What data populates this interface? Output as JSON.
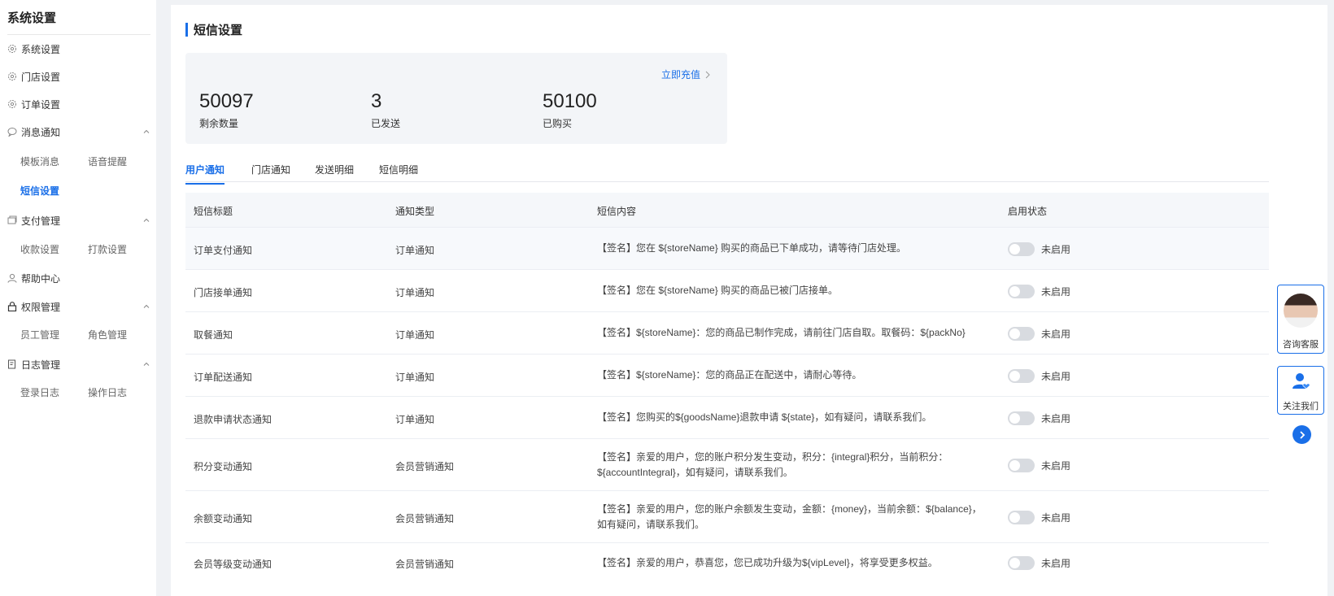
{
  "sidebar": {
    "title": "系统设置",
    "items": [
      {
        "label": "系统设置",
        "icon": "gear-icon"
      },
      {
        "label": "门店设置",
        "icon": "gear-icon"
      },
      {
        "label": "订单设置",
        "icon": "gear-icon"
      },
      {
        "label": "消息通知",
        "icon": "chat-icon",
        "sub": [
          "模板消息",
          "语音提醒",
          "短信设置"
        ]
      },
      {
        "label": "支付管理",
        "icon": "wallet-icon",
        "sub": [
          "收款设置",
          "打款设置"
        ]
      },
      {
        "label": "帮助中心",
        "icon": "user-icon"
      },
      {
        "label": "权限管理",
        "icon": "lock-icon",
        "sub": [
          "员工管理",
          "角色管理"
        ]
      },
      {
        "label": "日志管理",
        "icon": "log-icon",
        "sub": [
          "登录日志",
          "操作日志"
        ]
      }
    ]
  },
  "page": {
    "title": "短信设置"
  },
  "stats": {
    "recharge_label": "立即充值",
    "items": [
      {
        "value": "50097",
        "label": "剩余数量"
      },
      {
        "value": "3",
        "label": "已发送"
      },
      {
        "value": "50100",
        "label": "已购买"
      }
    ]
  },
  "tabs": [
    "用户通知",
    "门店通知",
    "发送明细",
    "短信明细"
  ],
  "table": {
    "headers": [
      "短信标题",
      "通知类型",
      "短信内容",
      "启用状态"
    ],
    "rows": [
      {
        "title": "订单支付通知",
        "type": "订单通知",
        "content": "【签名】您在 ${storeName} 购买的商品已下单成功，请等待门店处理。",
        "status": "未启用"
      },
      {
        "title": "门店接单通知",
        "type": "订单通知",
        "content": "【签名】您在 ${storeName} 购买的商品已被门店接单。",
        "status": "未启用"
      },
      {
        "title": "取餐通知",
        "type": "订单通知",
        "content": "【签名】${storeName}：您的商品已制作完成，请前往门店自取。取餐码：${packNo}",
        "status": "未启用"
      },
      {
        "title": "订单配送通知",
        "type": "订单通知",
        "content": "【签名】${storeName}：您的商品正在配送中，请耐心等待。",
        "status": "未启用"
      },
      {
        "title": "退款申请状态通知",
        "type": "订单通知",
        "content": "【签名】您购买的${goodsName}退款申请 ${state}，如有疑问，请联系我们。",
        "status": "未启用"
      },
      {
        "title": "积分变动通知",
        "type": "会员营销通知",
        "content": "【签名】亲爱的用户，您的账户积分发生变动，积分：{integral}积分，当前积分：${accountIntegral}，如有疑问，请联系我们。",
        "status": "未启用"
      },
      {
        "title": "余额变动通知",
        "type": "会员营销通知",
        "content": "【签名】亲爱的用户，您的账户余额发生变动，金额：{money}，当前余额：${balance}，如有疑问，请联系我们。",
        "status": "未启用"
      },
      {
        "title": "会员等级变动通知",
        "type": "会员营销通知",
        "content": "【签名】亲爱的用户，恭喜您，您已成功升级为${vipLevel}，将享受更多权益。",
        "status": "未启用"
      }
    ]
  },
  "float": {
    "service_label": "咨询客服",
    "follow_label": "关注我们"
  },
  "colors": {
    "accent": "#1a6fe8",
    "toggle_off": "#d8dbe0"
  }
}
